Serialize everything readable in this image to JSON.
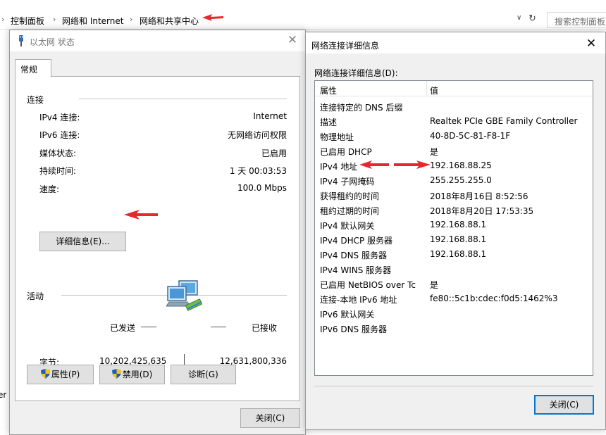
{
  "explorer": {
    "breadcrumb": [
      "控制面板",
      "网络和 Internet",
      "网络和共享中心"
    ],
    "search_placeholder": "搜索控制面板",
    "partial_left_text": "er E"
  },
  "status_dialog": {
    "title": "以太网 状态",
    "tab": "常规",
    "connection_group": "连接",
    "connection_rows": [
      {
        "label": "IPv4 连接:",
        "value": "Internet"
      },
      {
        "label": "IPv6 连接:",
        "value": "无网络访问权限"
      },
      {
        "label": "媒体状态:",
        "value": "已启用"
      },
      {
        "label": "持续时间:",
        "value": "1 天 00:03:53"
      },
      {
        "label": "速度:",
        "value": "100.0 Mbps"
      }
    ],
    "details_button": "详细信息(E)...",
    "activity_group": "活动",
    "sent_label": "已发送",
    "received_label": "已接收",
    "bytes_label": "字节:",
    "bytes_sent": "10,202,425,635",
    "bytes_received": "12,631,800,336",
    "properties_button": "属性(P)",
    "disable_button": "禁用(D)",
    "diagnose_button": "诊断(G)",
    "close_button": "关闭(C)"
  },
  "details_dialog": {
    "title": "网络连接详细信息",
    "list_caption": "网络连接详细信息(D):",
    "col_property": "属性",
    "col_value": "值",
    "rows": [
      {
        "property": "连接特定的 DNS 后缀",
        "value": ""
      },
      {
        "property": "描述",
        "value": "Realtek PCIe GBE Family Controller"
      },
      {
        "property": "物理地址",
        "value": "40-8D-5C-81-F8-1F"
      },
      {
        "property": "已启用 DHCP",
        "value": "是"
      },
      {
        "property": "IPv4 地址",
        "value": "192.168.88.25"
      },
      {
        "property": "IPv4 子网掩码",
        "value": "255.255.255.0"
      },
      {
        "property": "获得租约的时间",
        "value": "2018年8月16日 8:52:56"
      },
      {
        "property": "租约过期的时间",
        "value": "2018年8月20日 17:53:35"
      },
      {
        "property": "IPv4 默认网关",
        "value": "192.168.88.1"
      },
      {
        "property": "IPv4 DHCP 服务器",
        "value": "192.168.88.1"
      },
      {
        "property": "IPv4 DNS 服务器",
        "value": "192.168.88.1"
      },
      {
        "property": "IPv4 WINS 服务器",
        "value": ""
      },
      {
        "property": "已启用 NetBIOS over Tc",
        "value": "是"
      },
      {
        "property": "连接-本地 IPv6 地址",
        "value": "fe80::5c1b:cdec:f0d5:1462%3"
      },
      {
        "property": "IPv6 默认网关",
        "value": ""
      },
      {
        "property": "IPv6 DNS 服务器",
        "value": ""
      }
    ],
    "close_button": "关闭(C)"
  },
  "colors": {
    "annotation_arrow": "#e8262b",
    "dialog_bg": "#f0f0f0",
    "button_bg": "#e1e1e1",
    "default_button_border": "#0078d7"
  }
}
